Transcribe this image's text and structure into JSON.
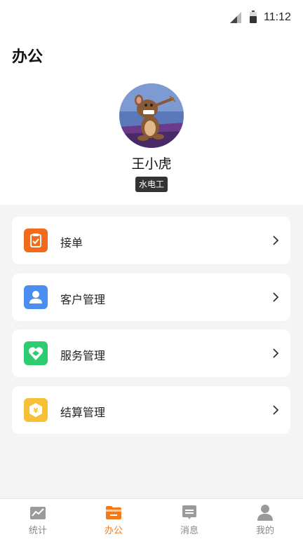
{
  "status_bar": {
    "time": "11:12"
  },
  "header": {
    "title": "办公"
  },
  "profile": {
    "name": "王小虎",
    "role": "水电工"
  },
  "menu": [
    {
      "label": "接单",
      "icon": "clipboard-check-icon",
      "color": "#f26b1d"
    },
    {
      "label": "客户管理",
      "icon": "user-icon",
      "color": "#4a8ff0"
    },
    {
      "label": "服务管理",
      "icon": "heart-handshake-icon",
      "color": "#2ecc71"
    },
    {
      "label": "结算管理",
      "icon": "yuan-coin-icon",
      "color": "#f5c035"
    }
  ],
  "bottom_nav": [
    {
      "label": "统计",
      "icon": "chart-icon",
      "active": false
    },
    {
      "label": "办公",
      "icon": "folder-icon",
      "active": true
    },
    {
      "label": "消息",
      "icon": "message-icon",
      "active": false
    },
    {
      "label": "我的",
      "icon": "person-icon",
      "active": false
    }
  ],
  "colors": {
    "accent": "#f27a1a",
    "inactive": "#888888",
    "background": "#f4f4f4"
  }
}
